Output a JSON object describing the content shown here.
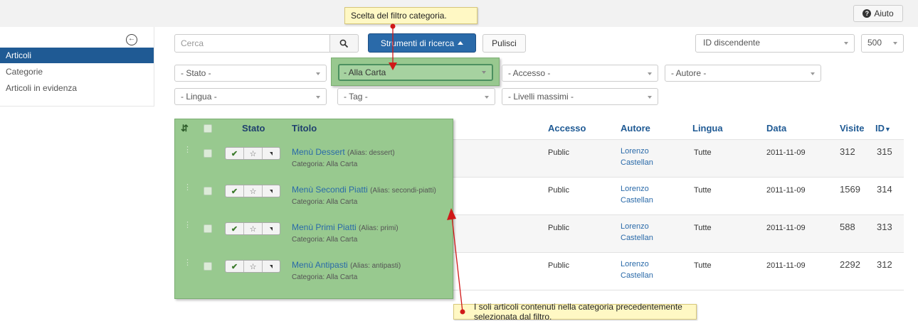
{
  "toolbar": {
    "help_label": "Aiuto"
  },
  "sidebar": {
    "items": [
      {
        "label": "Articoli",
        "active": true
      },
      {
        "label": "Categorie",
        "active": false
      },
      {
        "label": "Articoli in evidenza",
        "active": false
      }
    ]
  },
  "search": {
    "placeholder": "Cerca",
    "tools_label": "Strumenti di ricerca",
    "clear_label": "Pulisci",
    "sort_value": "ID discendente",
    "limit_value": "500"
  },
  "filters": {
    "stato": "- Stato -",
    "categoria": "- Alla Carta",
    "accesso": "- Accesso -",
    "autore": "- Autore -",
    "lingua": "- Lingua -",
    "tag": "- Tag -",
    "livelli": "- Livelli massimi -"
  },
  "table": {
    "headers": {
      "stato": "Stato",
      "titolo": "Titolo",
      "accesso": "Accesso",
      "autore": "Autore",
      "lingua": "Lingua",
      "data": "Data",
      "visite": "Visite",
      "id": "ID"
    },
    "rows": [
      {
        "title": "Menù Dessert",
        "alias": "(Alias: dessert)",
        "category": "Categoria: Alla Carta",
        "access": "Public",
        "author_first": "Lorenzo",
        "author_last": "Castellan",
        "language": "Tutte",
        "date": "2011-11-09",
        "hits": "312",
        "id": "315"
      },
      {
        "title": "Menù Secondi Piatti",
        "alias": "(Alias: secondi-piatti)",
        "category": "Categoria: Alla Carta",
        "access": "Public",
        "author_first": "Lorenzo",
        "author_last": "Castellan",
        "language": "Tutte",
        "date": "2011-11-09",
        "hits": "1569",
        "id": "314"
      },
      {
        "title": "Menù Primi Piatti",
        "alias": "(Alias: primi)",
        "category": "Categoria: Alla Carta",
        "access": "Public",
        "author_first": "Lorenzo",
        "author_last": "Castellan",
        "language": "Tutte",
        "date": "2011-11-09",
        "hits": "588",
        "id": "313"
      },
      {
        "title": "Menù Antipasti",
        "alias": "(Alias: antipasti)",
        "category": "Categoria: Alla Carta",
        "access": "Public",
        "author_first": "Lorenzo",
        "author_last": "Castellan",
        "language": "Tutte",
        "date": "2011-11-09",
        "hits": "2292",
        "id": "312"
      }
    ]
  },
  "callouts": {
    "top": "Scelta del filtro categoria.",
    "bottom": "I soli articoli contenuti nella categoria precedentemente selezionata dal filtro."
  },
  "colors": {
    "accent": "#2a6aa9",
    "sidebar_active": "#1f5a94",
    "highlight_green": "#98c98f",
    "callout_yellow": "#fff8c4",
    "arrow_red": "#d01818"
  }
}
